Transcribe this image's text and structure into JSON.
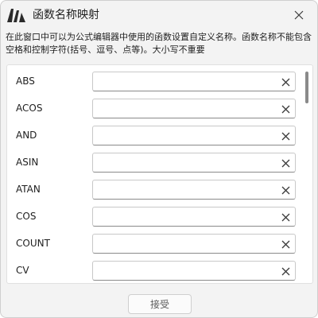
{
  "window": {
    "title": "函数名称映射",
    "description": "在此窗口中可以为公式编辑器中使用的函数设置自定义名称。函数名称不能包含空格和控制字符(括号、逗号、点等)。大小写不重要"
  },
  "functions": [
    {
      "name": "ABS",
      "value": ""
    },
    {
      "name": "ACOS",
      "value": ""
    },
    {
      "name": "AND",
      "value": ""
    },
    {
      "name": "ASIN",
      "value": ""
    },
    {
      "name": "ATAN",
      "value": ""
    },
    {
      "name": "COS",
      "value": ""
    },
    {
      "name": "COUNT",
      "value": ""
    },
    {
      "name": "CV",
      "value": ""
    }
  ],
  "footer": {
    "accept_label": "接受"
  },
  "icons": {
    "logo": "app-logo-icon",
    "close": "close-icon",
    "clear": "clear-x-icon"
  }
}
